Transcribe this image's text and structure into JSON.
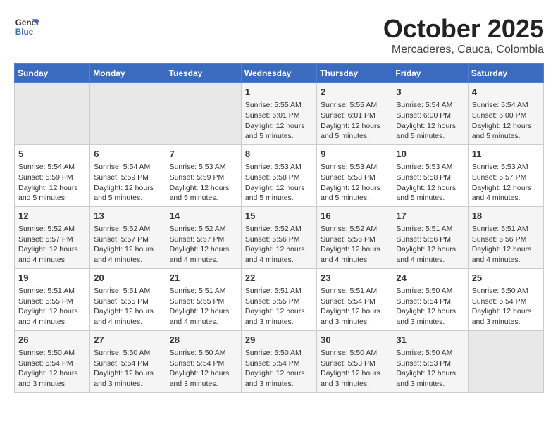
{
  "header": {
    "logo_line1": "General",
    "logo_line2": "Blue",
    "month": "October 2025",
    "location": "Mercaderes, Cauca, Colombia"
  },
  "weekdays": [
    "Sunday",
    "Monday",
    "Tuesday",
    "Wednesday",
    "Thursday",
    "Friday",
    "Saturday"
  ],
  "weeks": [
    [
      {
        "day": "",
        "info": ""
      },
      {
        "day": "",
        "info": ""
      },
      {
        "day": "",
        "info": ""
      },
      {
        "day": "1",
        "info": "Sunrise: 5:55 AM\nSunset: 6:01 PM\nDaylight: 12 hours\nand 5 minutes."
      },
      {
        "day": "2",
        "info": "Sunrise: 5:55 AM\nSunset: 6:01 PM\nDaylight: 12 hours\nand 5 minutes."
      },
      {
        "day": "3",
        "info": "Sunrise: 5:54 AM\nSunset: 6:00 PM\nDaylight: 12 hours\nand 5 minutes."
      },
      {
        "day": "4",
        "info": "Sunrise: 5:54 AM\nSunset: 6:00 PM\nDaylight: 12 hours\nand 5 minutes."
      }
    ],
    [
      {
        "day": "5",
        "info": "Sunrise: 5:54 AM\nSunset: 5:59 PM\nDaylight: 12 hours\nand 5 minutes."
      },
      {
        "day": "6",
        "info": "Sunrise: 5:54 AM\nSunset: 5:59 PM\nDaylight: 12 hours\nand 5 minutes."
      },
      {
        "day": "7",
        "info": "Sunrise: 5:53 AM\nSunset: 5:59 PM\nDaylight: 12 hours\nand 5 minutes."
      },
      {
        "day": "8",
        "info": "Sunrise: 5:53 AM\nSunset: 5:58 PM\nDaylight: 12 hours\nand 5 minutes."
      },
      {
        "day": "9",
        "info": "Sunrise: 5:53 AM\nSunset: 5:58 PM\nDaylight: 12 hours\nand 5 minutes."
      },
      {
        "day": "10",
        "info": "Sunrise: 5:53 AM\nSunset: 5:58 PM\nDaylight: 12 hours\nand 5 minutes."
      },
      {
        "day": "11",
        "info": "Sunrise: 5:53 AM\nSunset: 5:57 PM\nDaylight: 12 hours\nand 4 minutes."
      }
    ],
    [
      {
        "day": "12",
        "info": "Sunrise: 5:52 AM\nSunset: 5:57 PM\nDaylight: 12 hours\nand 4 minutes."
      },
      {
        "day": "13",
        "info": "Sunrise: 5:52 AM\nSunset: 5:57 PM\nDaylight: 12 hours\nand 4 minutes."
      },
      {
        "day": "14",
        "info": "Sunrise: 5:52 AM\nSunset: 5:57 PM\nDaylight: 12 hours\nand 4 minutes."
      },
      {
        "day": "15",
        "info": "Sunrise: 5:52 AM\nSunset: 5:56 PM\nDaylight: 12 hours\nand 4 minutes."
      },
      {
        "day": "16",
        "info": "Sunrise: 5:52 AM\nSunset: 5:56 PM\nDaylight: 12 hours\nand 4 minutes."
      },
      {
        "day": "17",
        "info": "Sunrise: 5:51 AM\nSunset: 5:56 PM\nDaylight: 12 hours\nand 4 minutes."
      },
      {
        "day": "18",
        "info": "Sunrise: 5:51 AM\nSunset: 5:56 PM\nDaylight: 12 hours\nand 4 minutes."
      }
    ],
    [
      {
        "day": "19",
        "info": "Sunrise: 5:51 AM\nSunset: 5:55 PM\nDaylight: 12 hours\nand 4 minutes."
      },
      {
        "day": "20",
        "info": "Sunrise: 5:51 AM\nSunset: 5:55 PM\nDaylight: 12 hours\nand 4 minutes."
      },
      {
        "day": "21",
        "info": "Sunrise: 5:51 AM\nSunset: 5:55 PM\nDaylight: 12 hours\nand 4 minutes."
      },
      {
        "day": "22",
        "info": "Sunrise: 5:51 AM\nSunset: 5:55 PM\nDaylight: 12 hours\nand 3 minutes."
      },
      {
        "day": "23",
        "info": "Sunrise: 5:51 AM\nSunset: 5:54 PM\nDaylight: 12 hours\nand 3 minutes."
      },
      {
        "day": "24",
        "info": "Sunrise: 5:50 AM\nSunset: 5:54 PM\nDaylight: 12 hours\nand 3 minutes."
      },
      {
        "day": "25",
        "info": "Sunrise: 5:50 AM\nSunset: 5:54 PM\nDaylight: 12 hours\nand 3 minutes."
      }
    ],
    [
      {
        "day": "26",
        "info": "Sunrise: 5:50 AM\nSunset: 5:54 PM\nDaylight: 12 hours\nand 3 minutes."
      },
      {
        "day": "27",
        "info": "Sunrise: 5:50 AM\nSunset: 5:54 PM\nDaylight: 12 hours\nand 3 minutes."
      },
      {
        "day": "28",
        "info": "Sunrise: 5:50 AM\nSunset: 5:54 PM\nDaylight: 12 hours\nand 3 minutes."
      },
      {
        "day": "29",
        "info": "Sunrise: 5:50 AM\nSunset: 5:54 PM\nDaylight: 12 hours\nand 3 minutes."
      },
      {
        "day": "30",
        "info": "Sunrise: 5:50 AM\nSunset: 5:53 PM\nDaylight: 12 hours\nand 3 minutes."
      },
      {
        "day": "31",
        "info": "Sunrise: 5:50 AM\nSunset: 5:53 PM\nDaylight: 12 hours\nand 3 minutes."
      },
      {
        "day": "",
        "info": ""
      }
    ]
  ]
}
